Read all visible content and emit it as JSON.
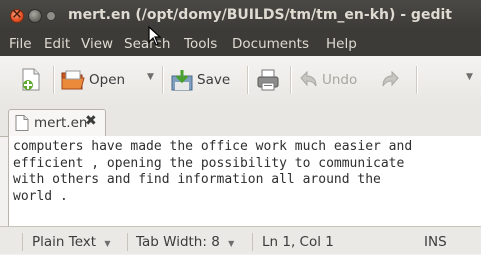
{
  "window": {
    "title": "mert.en (/opt/domy/BUILDS/tm/tm_en-kh) - gedit"
  },
  "menu": {
    "items": [
      "File",
      "Edit",
      "View",
      "Search",
      "Tools",
      "Documents",
      "Help"
    ]
  },
  "toolbar": {
    "open_label": "Open",
    "save_label": "Save",
    "undo_label": "Undo"
  },
  "tabs": [
    {
      "label": "mert.en"
    }
  ],
  "editor": {
    "text": "computers have made the office work much easier and\nefficient , opening the possibility to communicate\nwith others and find information all around the\nworld ."
  },
  "statusbar": {
    "syntax": "Plain Text",
    "tab_width": "Tab Width: 8",
    "position": "Ln 1, Col 1",
    "mode": "INS"
  },
  "colors": {
    "titlebar": "#3c3b37",
    "close_button": "#e6542a",
    "window_bg": "#f2f1f0"
  }
}
